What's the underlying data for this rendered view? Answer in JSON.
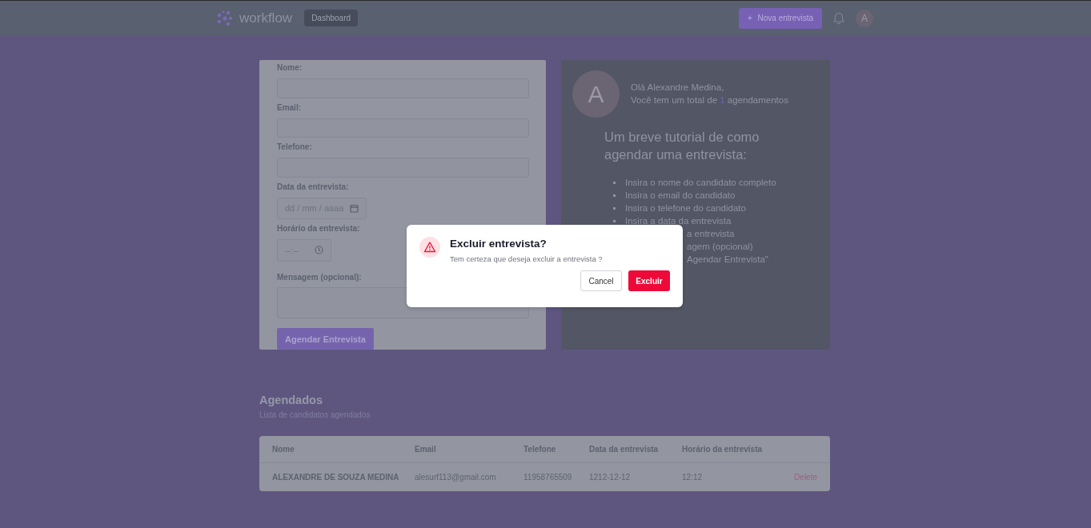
{
  "navbar": {
    "brand": "workflow",
    "nav_items": [
      {
        "label": "Dashboard",
        "selected": true
      }
    ],
    "new_button_icon": "+",
    "new_button": "Nova entrevista",
    "avatar": "A"
  },
  "form": {
    "fields": [
      {
        "label": "Nome:",
        "kind": "text"
      },
      {
        "label": "Email:",
        "kind": "text"
      },
      {
        "label": "Telefone:",
        "kind": "text"
      },
      {
        "label": "Data da entrevista:",
        "kind": "date",
        "placeholder": "dd / mm / aaaa"
      },
      {
        "label": "Horário da entrevista:",
        "kind": "time",
        "placeholder": "--:--"
      },
      {
        "label": "Mensagem (opcional):",
        "kind": "textarea"
      }
    ],
    "submit": "Agendar Entrevista"
  },
  "welcome": {
    "avatar": "A",
    "greeting": "Olá Alexandre Medina,",
    "total_before": "Você tem um total de ",
    "total_count": "1",
    "total_after": " agendamentos",
    "tutorial_title": "Um breve tutorial de como agendar uma entrevista:",
    "steps": [
      {
        "text": "Insira o nome do candidato completo",
        "clipped": false
      },
      {
        "text": "Insira o email do candidato",
        "clipped": false
      },
      {
        "text": "Insira o telefone do candidato",
        "clipped": false
      },
      {
        "text": "Insira a data da entrevista",
        "clipped": false
      },
      {
        "text": "a entrevista",
        "clipped": true
      },
      {
        "text": "agem (opcional)",
        "clipped": true
      },
      {
        "text": "Agendar Entrevista\"",
        "clipped": true
      }
    ]
  },
  "scheduled": {
    "title": "Agendados",
    "subtitle": "Lista de candidatos agendados",
    "table": {
      "columns": [
        "Nome",
        "Email",
        "Telefone",
        "Data da entrevista",
        "Horário da entrevista"
      ],
      "rows": [
        {
          "cells": [
            "ALEXANDRE DE SOUZA MEDINA",
            "alesurf113@gmail.com",
            "11958765509",
            "1212-12-12",
            "12:12"
          ],
          "action": "Delete"
        }
      ]
    }
  },
  "dialog": {
    "title": "Excluir entrevista?",
    "message": "Tem certeza que deseja excluir a entrevista ?",
    "cancel": "Cancel",
    "confirm": "Excluir"
  }
}
